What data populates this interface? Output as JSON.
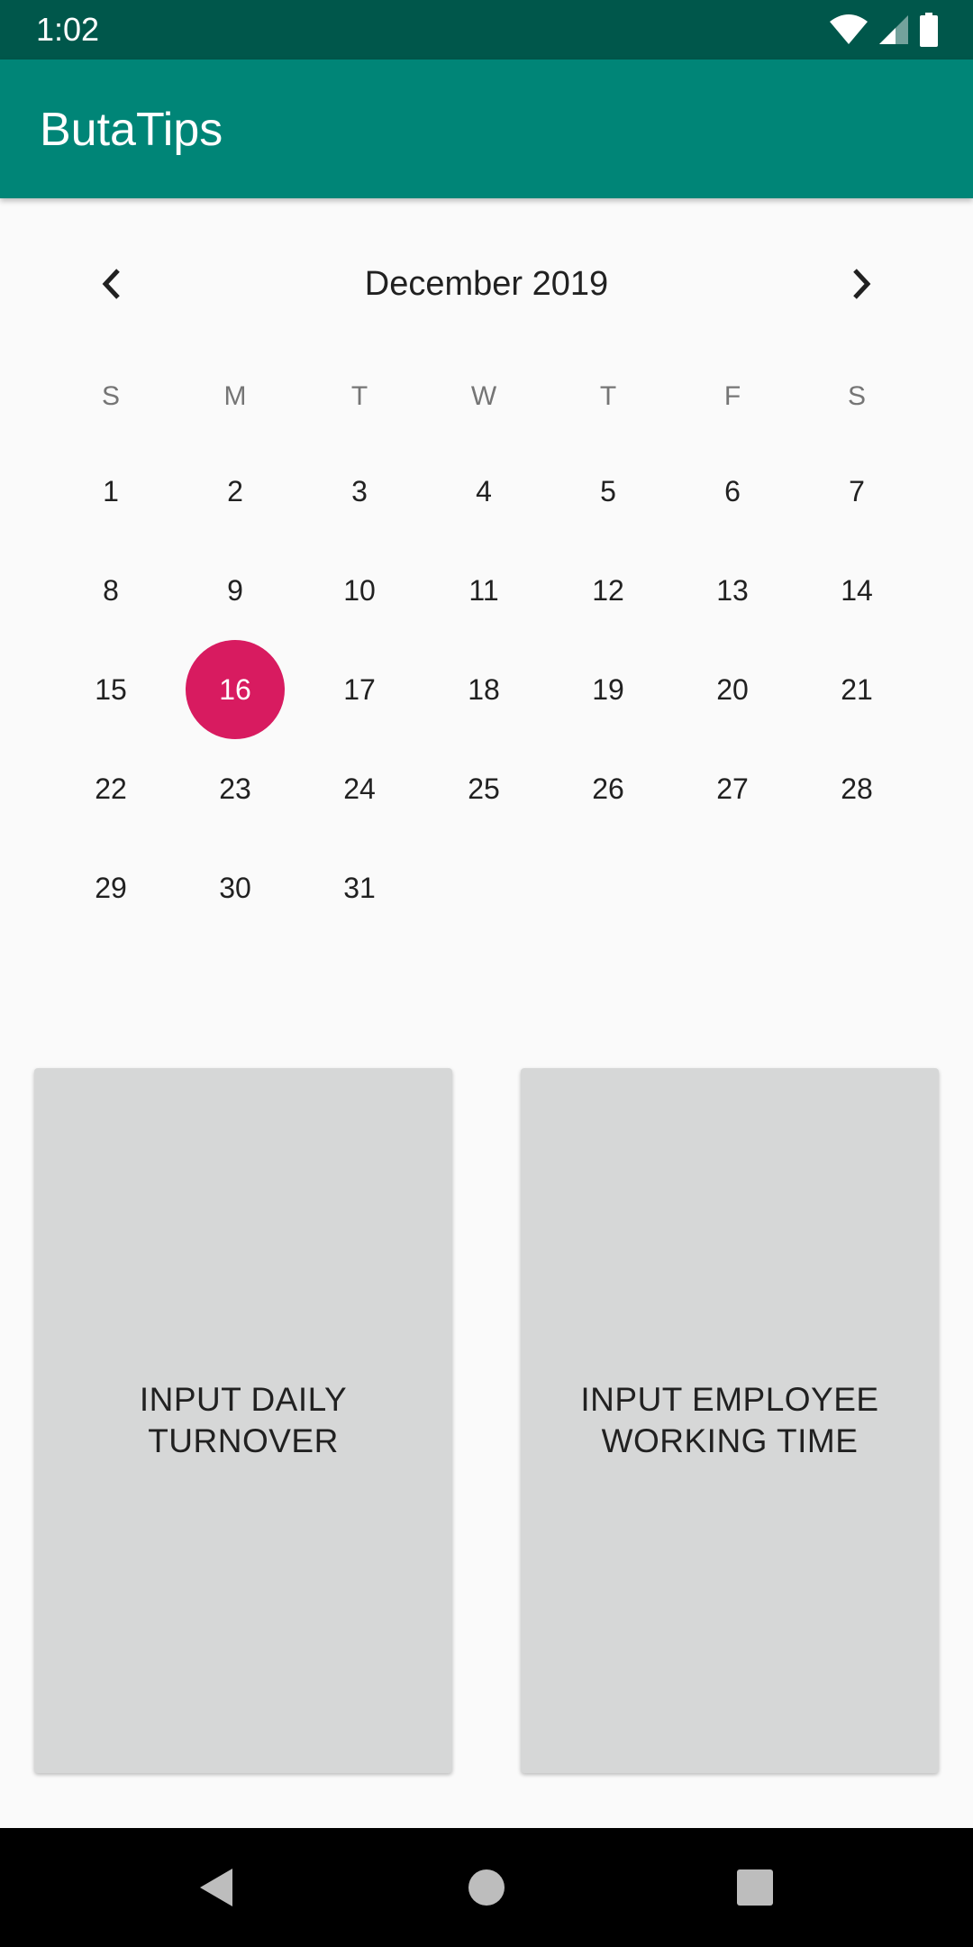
{
  "status_bar": {
    "time": "1:02",
    "icons": [
      "wifi-icon",
      "signal-icon",
      "battery-icon"
    ]
  },
  "app_bar": {
    "title": "ButaTips"
  },
  "calendar": {
    "month_label": "December 2019",
    "prev_icon": "chevron-left-icon",
    "next_icon": "chevron-right-icon",
    "days_of_week": [
      "S",
      "M",
      "T",
      "W",
      "T",
      "F",
      "S"
    ],
    "weeks": [
      [
        "1",
        "2",
        "3",
        "4",
        "5",
        "6",
        "7"
      ],
      [
        "8",
        "9",
        "10",
        "11",
        "12",
        "13",
        "14"
      ],
      [
        "15",
        "16",
        "17",
        "18",
        "19",
        "20",
        "21"
      ],
      [
        "22",
        "23",
        "24",
        "25",
        "26",
        "27",
        "28"
      ],
      [
        "29",
        "30",
        "31",
        "",
        "",
        "",
        ""
      ]
    ],
    "selected_day": "16",
    "selected_color": "#d81b60"
  },
  "actions": {
    "daily_turnover_label": "INPUT DAILY\nTURNOVER",
    "employee_time_label": "INPUT EMPLOYEE\nWORKING TIME"
  },
  "colors": {
    "primary": "#008577",
    "primary_dark": "#00574b",
    "accent": "#d81b60"
  },
  "nav_bar": {
    "icons": [
      "back-icon",
      "home-icon",
      "recents-icon"
    ]
  }
}
